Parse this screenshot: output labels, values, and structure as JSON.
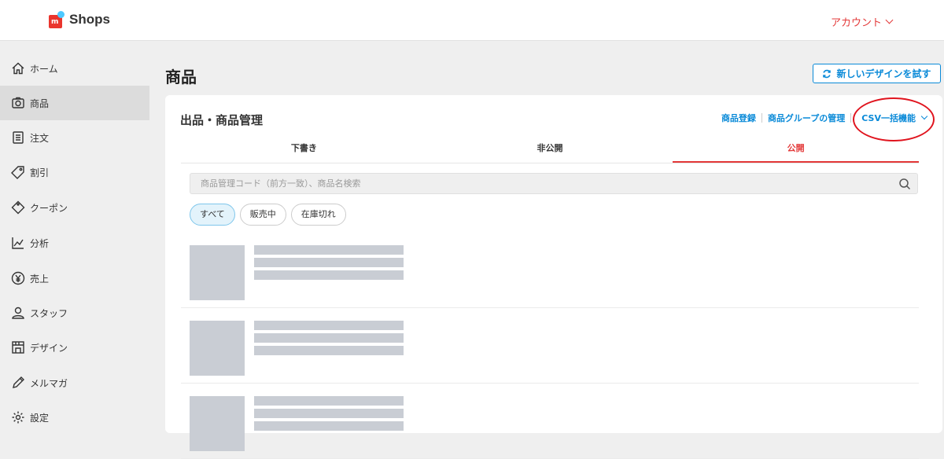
{
  "header": {
    "logo_text": "Shops",
    "logo_mark": "m",
    "account_label": "アカウント"
  },
  "sidebar": {
    "items": [
      {
        "label": "ホーム",
        "icon": "home-icon"
      },
      {
        "label": "商品",
        "icon": "camera-icon",
        "active": true
      },
      {
        "label": "注文",
        "icon": "list-icon"
      },
      {
        "label": "割引",
        "icon": "tag-icon"
      },
      {
        "label": "クーポン",
        "icon": "coupon-icon"
      },
      {
        "label": "分析",
        "icon": "chart-icon"
      },
      {
        "label": "売上",
        "icon": "yen-icon"
      },
      {
        "label": "スタッフ",
        "icon": "person-icon"
      },
      {
        "label": "デザイン",
        "icon": "store-icon"
      },
      {
        "label": "メルマガ",
        "icon": "pen-icon"
      },
      {
        "label": "設定",
        "icon": "gear-icon"
      }
    ]
  },
  "main": {
    "page_title": "商品",
    "try_design_label": "新しいデザインを試す",
    "card": {
      "title": "出品・商品管理",
      "links": {
        "register": "商品登録",
        "group": "商品グループの管理",
        "csv": "CSV一括機能"
      },
      "tabs": [
        {
          "label": "下書き",
          "active": false
        },
        {
          "label": "非公開",
          "active": false
        },
        {
          "label": "公開",
          "active": true
        }
      ],
      "search": {
        "placeholder": "商品管理コード（前方一致）、商品名検索",
        "value": ""
      },
      "filters": [
        {
          "label": "すべて",
          "active": true
        },
        {
          "label": "販売中",
          "active": false
        },
        {
          "label": "在庫切れ",
          "active": false
        }
      ]
    }
  },
  "colors": {
    "accent_blue": "#0a8ad8",
    "accent_red": "#e33838",
    "placeholder_gray": "#c9cdd4",
    "annotation_circle": "#e0141e"
  }
}
